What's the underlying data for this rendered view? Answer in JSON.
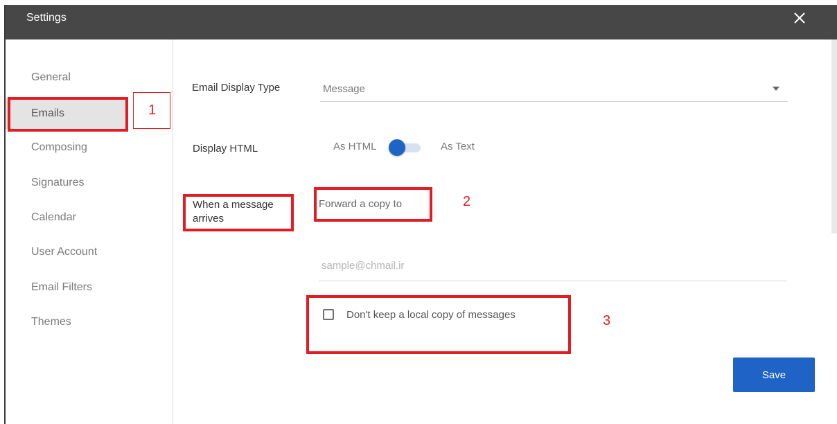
{
  "window": {
    "title": "Settings"
  },
  "sidebar": {
    "items": [
      {
        "label": "General"
      },
      {
        "label": "Emails",
        "active": true
      },
      {
        "label": "Composing"
      },
      {
        "label": "Signatures"
      },
      {
        "label": "Calendar"
      },
      {
        "label": "User Account"
      },
      {
        "label": "Email Filters"
      },
      {
        "label": "Themes"
      }
    ]
  },
  "email_display_type": {
    "label": "Email Display Type",
    "value": "Message"
  },
  "display_html": {
    "label": "Display HTML",
    "option_left": "As HTML",
    "option_right": "As Text",
    "selected": "As HTML"
  },
  "message_arrives": {
    "label": "When a message arrives",
    "action": "Forward a copy to"
  },
  "forward_email": {
    "placeholder": "sample@chmail.ir",
    "value": ""
  },
  "keep_local": {
    "label": "Don't keep a local copy of messages",
    "checked": false
  },
  "save_label": "Save",
  "annotations": [
    "1",
    "2",
    "3"
  ],
  "colors": {
    "titlebar": "#474747",
    "accent": "#1f63c6",
    "annotation": "#e31b23"
  }
}
